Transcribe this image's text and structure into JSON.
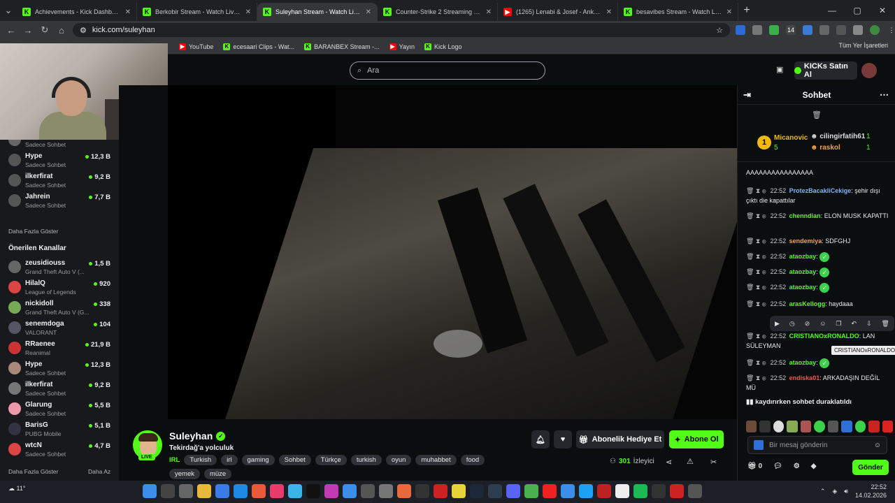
{
  "browser": {
    "tabs": [
      {
        "title": "Achievements - Kick Dashboard",
        "icon": "K",
        "active": false
      },
      {
        "title": "Berkobir Stream - Watch Live o",
        "icon": "K",
        "active": false
      },
      {
        "title": "Suleyhan Stream - Watch Live o",
        "icon": "K",
        "active": true
      },
      {
        "title": "Counter-Strike 2 Streaming - Li",
        "icon": "K",
        "active": false
      },
      {
        "title": "(1265) Lenabi & Josef - Ankara",
        "icon": "yt",
        "active": false
      },
      {
        "title": "besavibes Stream - Watch Live",
        "icon": "K",
        "active": false
      }
    ],
    "url": "kick.com/suleyhan",
    "bookmarks": [
      {
        "label": "YouTube",
        "icon": "yt"
      },
      {
        "label": "ecesaari Clips - Wat...",
        "icon": "K"
      },
      {
        "label": "BARANBEX Stream -...",
        "icon": "K"
      },
      {
        "label": "Yayın",
        "icon": "yt"
      },
      {
        "label": "Kick Logo",
        "icon": "K"
      }
    ],
    "all_bookmarks": "Tüm Yer İşaretleri"
  },
  "header": {
    "search_placeholder": "Ara",
    "kicks_button": "KICKs Satın Al"
  },
  "sidebar": {
    "followed": [
      {
        "name": "",
        "category": "Sadece Sohbet",
        "viewers": ""
      },
      {
        "name": "Hype",
        "category": "Sadece Sohbet",
        "viewers": "12,3 B"
      },
      {
        "name": "ilkerfirat",
        "category": "Sadece Sohbet",
        "viewers": "9,2 B"
      },
      {
        "name": "Jahrein",
        "category": "Sadece Sohbet",
        "viewers": "7,7 B"
      }
    ],
    "show_more_1": "Daha Fazla Göster",
    "recommended_title": "Önerilen Kanallar",
    "recommended": [
      {
        "name": "zeusidiouss",
        "category": "Grand Theft Auto V (...",
        "viewers": "1,5 B"
      },
      {
        "name": "HilalQ",
        "category": "League of Legends",
        "viewers": "920"
      },
      {
        "name": "nickidoll",
        "category": "Grand Theft Auto V (G...",
        "viewers": "338"
      },
      {
        "name": "senemdoga",
        "category": "VALORANT",
        "viewers": "104"
      },
      {
        "name": "RRaenee",
        "category": "Reanimal",
        "viewers": "21,9 B"
      },
      {
        "name": "Hype",
        "category": "Sadece Sohbet",
        "viewers": "12,3 B"
      },
      {
        "name": "ilkerfirat",
        "category": "Sadece Sohbet",
        "viewers": "9,2 B"
      },
      {
        "name": "Glarung",
        "category": "Sadece Sohbet",
        "viewers": "5,5 B"
      },
      {
        "name": "BarisG",
        "category": "PUBG Mobile",
        "viewers": "5,1 B"
      },
      {
        "name": "wtcN",
        "category": "Sadece Sohbet",
        "viewers": "4,7 B"
      }
    ],
    "show_more_2": "Daha Fazla Göster",
    "show_less": "Daha Az"
  },
  "stream": {
    "name": "Suleyhan",
    "live": "LIVE",
    "title": "Tekirdağ'a yolculuk",
    "category": "IRL",
    "tags": [
      "Turkish",
      "irl",
      "gaming",
      "Sohbet",
      "Türkçe",
      "turkish",
      "oyun",
      "muhabbet",
      "food",
      "yemek",
      "müze"
    ],
    "gift_button": "Abonelik Hediye Et",
    "subscribe_button": "Abone Ol",
    "viewers": "301",
    "viewers_label": "İzleyici"
  },
  "chat": {
    "title": "Sohbet",
    "leaderboard": [
      {
        "rank": "1",
        "name": "Micanovic",
        "count": "5"
      },
      {
        "name": "cilingirfatih61",
        "count": "1"
      },
      {
        "name": "raskol",
        "count": "1"
      }
    ],
    "messages": [
      {
        "time": "",
        "user": "",
        "color": "#ff4d4d",
        "text": "AAAAAAAAAAAAAAAA"
      },
      {
        "time": "22:52",
        "user": "ProtezBacakliCekige",
        "color": "#7fb2ff",
        "text": ": şehir dışı çıktı die kapattılar"
      },
      {
        "time": "22:52",
        "user": "chenndian",
        "color": "#53fc18",
        "text": ": ELON MUSK KAPATTI"
      },
      {
        "time": "22:52",
        "user": "sendemiya",
        "color": "#ff9f40",
        "text": ": SDFGHJ"
      },
      {
        "time": "22:52",
        "user": "ataozbay",
        "color": "#53fc18",
        "text": ":"
      },
      {
        "time": "22:52",
        "user": "ataozbay",
        "color": "#53fc18",
        "text": ":"
      },
      {
        "time": "22:52",
        "user": "ataozbay",
        "color": "#53fc18",
        "text": ":"
      },
      {
        "time": "22:52",
        "user": "arasKellogg",
        "color": "#53fc18",
        "text": ": haydaaa"
      },
      {
        "time": "22:52",
        "user": "CRISTIANOxRONALDO",
        "color": "#53fc18",
        "text": ": LAN SÜLEYMAN"
      },
      {
        "time": "22:52",
        "user": "ataozbay",
        "color": "#53fc18",
        "text": ":"
      },
      {
        "time": "22:52",
        "user": "endiska01",
        "color": "#ff4d4d",
        "text": ": ARKADAŞIN DEĞİL MÜ"
      }
    ],
    "tooltip": "CRISTIANOxRONALDO",
    "pause_note": "kaydırırken sohbet duraklatıldı",
    "input_placeholder": "Bir mesaj gönderin",
    "balance": "0",
    "send": "Gönder"
  },
  "taskbar": {
    "temp": "11°",
    "time": "22:52",
    "date": "14.02.2026"
  },
  "colors": {
    "accent": "#53fc18",
    "bg": "#0b0e0f",
    "sidebar": "#18191c"
  }
}
